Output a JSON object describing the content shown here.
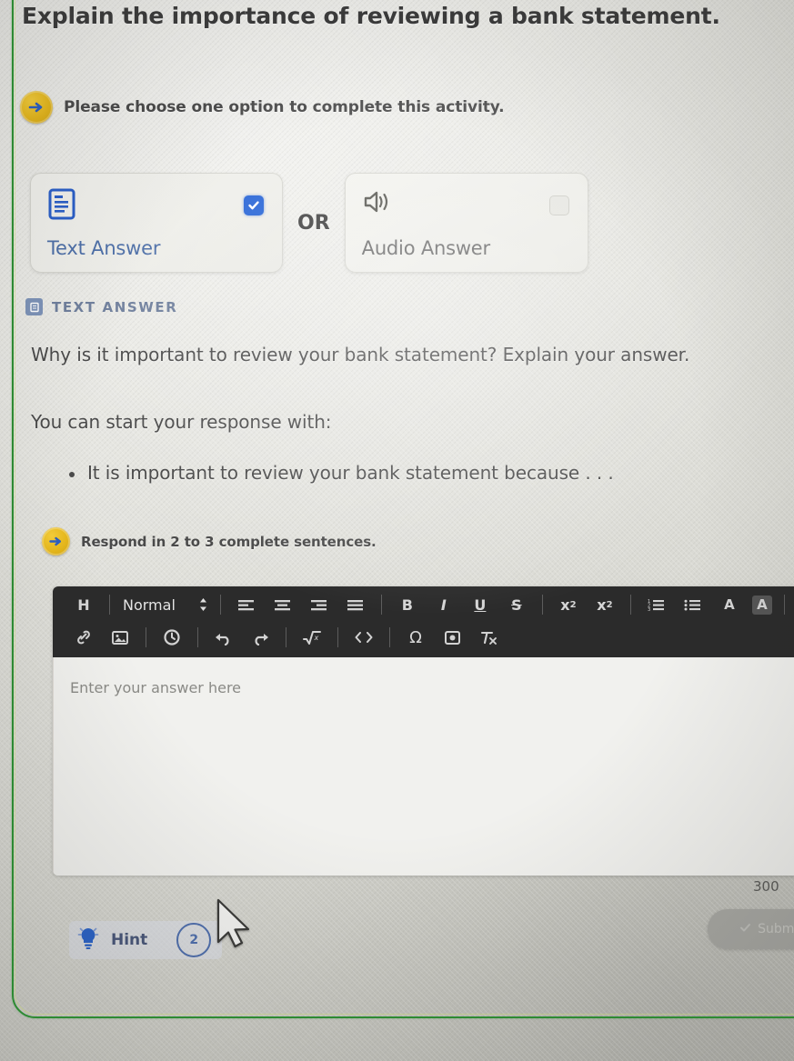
{
  "activity": {
    "title": "Explain the importance of reviewing a bank statement.",
    "choose_instruction": "Please choose one option to complete this activity.",
    "respond_instruction": "Respond in 2 to 3 complete sentences."
  },
  "options": {
    "or_label": "OR",
    "items": [
      {
        "label": "Text Answer",
        "icon": "document-text-icon",
        "selected": true,
        "check_state": "checked"
      },
      {
        "label": "Audio Answer",
        "icon": "speaker-icon",
        "selected": false,
        "check_state": "unchecked"
      }
    ]
  },
  "text_answer_section": {
    "header_label": "TEXT ANSWER",
    "header_icon": "document-text-icon",
    "question": "Why is it important to review your bank statement? Explain your answer.",
    "starter_intro": "You can start your response with:",
    "starter_bullet": "It is important to review your bank statement because . . ."
  },
  "editor": {
    "placeholder": "Enter your answer here",
    "value": "",
    "toolbar": {
      "rows": [
        {
          "groups": [
            [
              {
                "name": "heading-button",
                "glyph": "H"
              }
            ],
            [
              {
                "name": "paragraph-format-select",
                "glyph": "Normal",
                "type": "select"
              }
            ],
            [
              {
                "name": "align-left-button",
                "glyph": "align-left-icon"
              },
              {
                "name": "align-center-button",
                "glyph": "align-center-icon"
              },
              {
                "name": "align-right-button",
                "glyph": "align-right-icon"
              },
              {
                "name": "align-justify-button",
                "glyph": "align-justify-icon"
              }
            ],
            [
              {
                "name": "bold-button",
                "glyph": "B"
              },
              {
                "name": "italic-button",
                "glyph": "I"
              },
              {
                "name": "underline-button",
                "glyph": "U"
              },
              {
                "name": "strikethrough-button",
                "glyph": "S"
              }
            ],
            [
              {
                "name": "subscript-button",
                "glyph": "x2"
              },
              {
                "name": "superscript-button",
                "glyph": "x2sup"
              }
            ],
            [
              {
                "name": "ordered-list-button",
                "glyph": "ordered-list-icon"
              },
              {
                "name": "unordered-list-button",
                "glyph": "unordered-list-icon"
              },
              {
                "name": "text-color-button",
                "glyph": "A"
              },
              {
                "name": "highlight-color-button",
                "glyph": "A-highlight"
              }
            ]
          ]
        },
        {
          "groups": [
            [
              {
                "name": "insert-link-button",
                "glyph": "link-icon"
              },
              {
                "name": "insert-image-button",
                "glyph": "image-icon"
              }
            ],
            [
              {
                "name": "history-button",
                "glyph": "clock-icon"
              }
            ],
            [
              {
                "name": "undo-button",
                "glyph": "undo-icon"
              },
              {
                "name": "redo-button",
                "glyph": "redo-icon"
              }
            ],
            [
              {
                "name": "formula-button",
                "glyph": "sqrt-icon"
              }
            ],
            [
              {
                "name": "code-button",
                "glyph": "code-icon"
              }
            ],
            [
              {
                "name": "special-character-button",
                "glyph": "omega-icon"
              },
              {
                "name": "insert-media-button",
                "glyph": "media-icon"
              },
              {
                "name": "clear-formatting-button",
                "glyph": "clear-format-icon"
              }
            ]
          ]
        }
      ],
      "select_value": "Normal",
      "heading_glyph": "H",
      "bold_glyph": "B",
      "italic_glyph": "I",
      "underline_glyph": "U",
      "strike_glyph": "S",
      "subscript_glyph": "x",
      "subscript_index": "2",
      "superscript_glyph": "x",
      "superscript_index": "2",
      "color_glyph": "A",
      "highlight_glyph": "A",
      "omega_glyph": "Ω"
    }
  },
  "footer": {
    "char_count": "300 ",
    "submit_label": "Submit",
    "hint_label": "Hint",
    "hint_count": "2",
    "hint_icon": "lightbulb-icon"
  }
}
